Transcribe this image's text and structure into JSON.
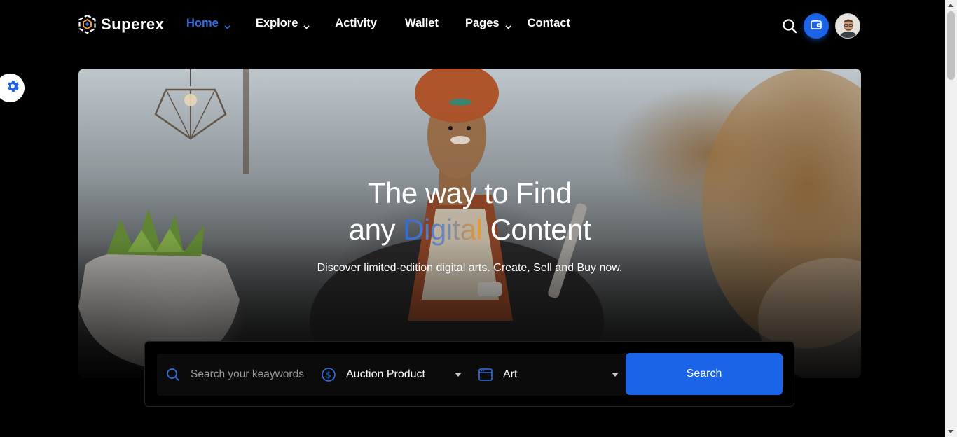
{
  "brand": {
    "name": "Superex",
    "logo_icon": "hexagon-cube-logo"
  },
  "nav": {
    "items": [
      {
        "label": "Home",
        "has_dropdown": true,
        "active": true
      },
      {
        "label": "Explore",
        "has_dropdown": true,
        "active": false
      },
      {
        "label": "Activity",
        "has_dropdown": false,
        "active": false
      },
      {
        "label": "Wallet",
        "has_dropdown": false,
        "active": false
      },
      {
        "label": "Pages",
        "has_dropdown": true,
        "active": false
      },
      {
        "label": "Contact",
        "has_dropdown": false,
        "active": false
      }
    ]
  },
  "header_actions": {
    "search_icon": "search-icon",
    "wallet_icon": "wallet-icon",
    "avatar": "user-avatar"
  },
  "settings": {
    "icon": "gear-icon"
  },
  "hero": {
    "title_line1": "The way to Find",
    "title_line2_prefix": "any ",
    "title_highlight": "Digital",
    "title_line2_suffix": " Content",
    "subtitle": "Discover limited-edition digital arts. Create, Sell and Buy now."
  },
  "search": {
    "keyword_placeholder": "Search your keaywords",
    "category_selected": "Auction Product",
    "type_selected": "Art",
    "submit_label": "Search"
  },
  "colors": {
    "accent": "#1b64e8",
    "active_nav": "#2f6fe8",
    "highlight_orange": "#f09a2c",
    "background": "#000000"
  }
}
